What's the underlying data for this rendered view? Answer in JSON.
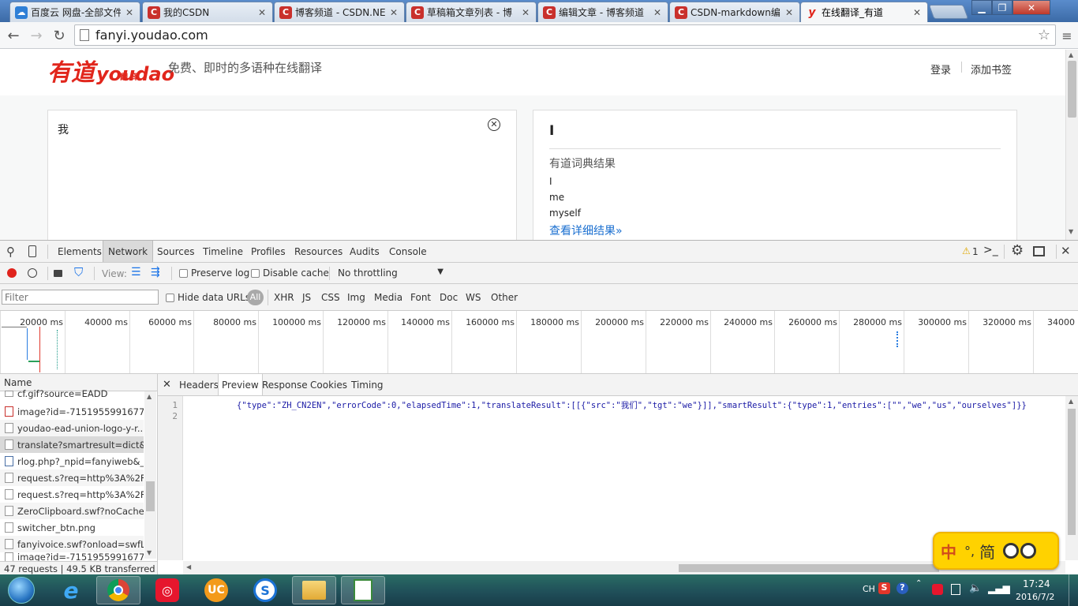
{
  "browser": {
    "tabs": [
      {
        "label": "百度云 网盘-全部文件",
        "icon": "baidu-cloud-icon",
        "color": "#2f7fd6"
      },
      {
        "label": "我的CSDN",
        "icon": "csdn-icon",
        "color": "#c9302c"
      },
      {
        "label": "博客频道 - CSDN.NE",
        "icon": "csdn-icon",
        "color": "#c9302c"
      },
      {
        "label": "草稿箱文章列表 - 博",
        "icon": "csdn-icon",
        "color": "#c9302c"
      },
      {
        "label": "编辑文章 - 博客频道",
        "icon": "csdn-icon",
        "color": "#c9302c"
      },
      {
        "label": "CSDN-markdown编",
        "icon": "csdn-icon",
        "color": "#c9302c"
      },
      {
        "label": "在线翻译_有道",
        "icon": "youdao-icon",
        "color": "#e1261c",
        "active": true
      }
    ],
    "url": "fanyi.youdao.com"
  },
  "page": {
    "logo_text": "youdao",
    "logo_sub": "翻 译",
    "logo_cn": "有道",
    "tagline": "免费、即时的多语种在线翻译",
    "login": "登录",
    "bookmark": "添加书签",
    "input_text": "我",
    "result_main": "I",
    "dict_title": "有道词典结果",
    "dict_entries": [
      "I",
      "me",
      "myself"
    ],
    "more_link": "查看详细结果»"
  },
  "devtools": {
    "tabs": [
      "Elements",
      "Network",
      "Sources",
      "Timeline",
      "Profiles",
      "Resources",
      "Audits",
      "Console"
    ],
    "selected_tab": "Network",
    "warning_count": "1",
    "view_label": "View:",
    "preserve_log": "Preserve log",
    "disable_cache": "Disable cache",
    "throttle": "No throttling",
    "filter_placeholder": "Filter",
    "hide_data_urls": "Hide data URLs",
    "type_filters": [
      "All",
      "XHR",
      "JS",
      "CSS",
      "Img",
      "Media",
      "Font",
      "Doc",
      "WS",
      "Other"
    ],
    "timeline_ticks": [
      "20000 ms",
      "40000 ms",
      "60000 ms",
      "80000 ms",
      "100000 ms",
      "120000 ms",
      "140000 ms",
      "160000 ms",
      "180000 ms",
      "200000 ms",
      "220000 ms",
      "240000 ms",
      "260000 ms",
      "280000 ms",
      "300000 ms",
      "320000 ms",
      "34000"
    ],
    "name_header": "Name",
    "requests": [
      "cf.gif?source=EADD",
      "image?id=-7151955991677...",
      "youdao-ead-union-logo-y-r...",
      "translate?smartresult=dict&...",
      "rlog.php?_npid=fanyiweb&_...",
      "request.s?req=http%3A%2F...",
      "request.s?req=http%3A%2F...",
      "ZeroClipboard.swf?noCache...",
      "switcher_btn.png",
      "fanyivoice.swf?onload=swfL...",
      "image?id=-7151955991677..."
    ],
    "selected_request_index": 3,
    "summary": "47 requests | 49.5 KB transferred | ...",
    "detail_tabs": [
      "Headers",
      "Preview",
      "Response",
      "Cookies",
      "Timing"
    ],
    "detail_selected": "Preview",
    "line_numbers": [
      "1",
      "2"
    ],
    "response_json": "{\"type\":\"ZH_CN2EN\",\"errorCode\":0,\"elapsedTime\":1,\"translateResult\":[[{\"src\":\"我们\",\"tgt\":\"we\"}]],\"smartResult\":{\"type\":1,\"entries\":[\"\",\"we\",\"us\",\"ourselves\"]}}"
  },
  "ime": {
    "lang": "中",
    "punct": "°,",
    "mode": "简"
  },
  "taskbar": {
    "apps": [
      "start-orb",
      "ie-icon",
      "chrome-icon",
      "weibo-icon",
      "uc-browser-icon",
      "sogou-icon",
      "explorer-folder-icon",
      "notepad-icon"
    ],
    "lang": "CH",
    "time": "17:24",
    "date": "2016/7/2"
  }
}
